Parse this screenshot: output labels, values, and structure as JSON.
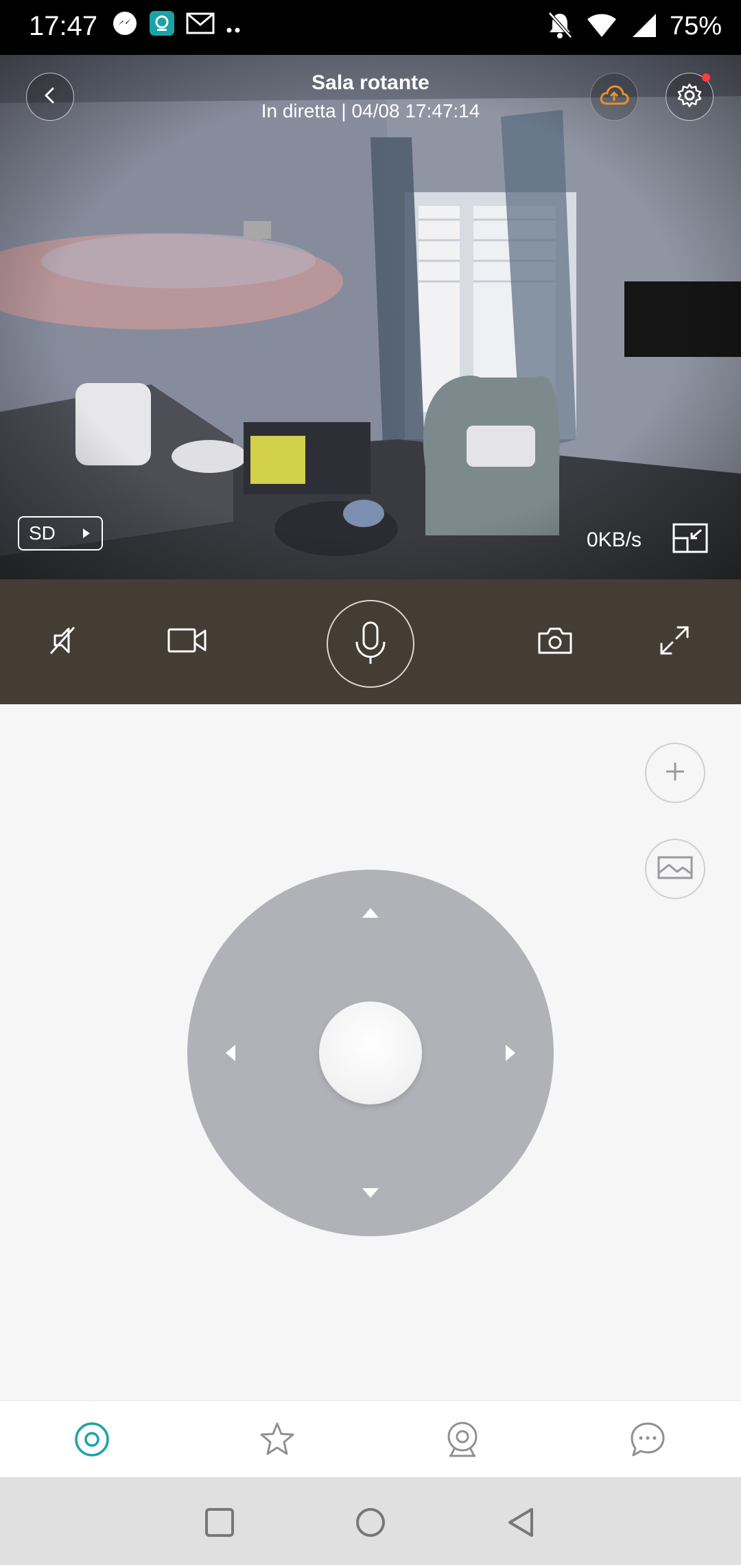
{
  "status_bar": {
    "time": "17:47",
    "battery": "75%",
    "left_icons": [
      "messenger-icon",
      "camera-app-icon",
      "gmail-icon",
      "more-dots-icon"
    ],
    "right_icons": [
      "mute-icon",
      "wifi-icon",
      "signal-icon"
    ]
  },
  "camera": {
    "title": "Sala rotante",
    "subtitle": "In diretta | 04/08 17:47:14",
    "quality_label": "SD",
    "speed": "0KB/s"
  },
  "controls": {
    "items": [
      "mute-icon",
      "record-icon",
      "microphone-icon",
      "snapshot-icon",
      "fullscreen-icon"
    ]
  },
  "side_actions": [
    "zoom-in-icon",
    "gallery-icon"
  ],
  "tabs": [
    "live-icon",
    "favorites-icon",
    "camera-icon",
    "messages-icon"
  ],
  "colors": {
    "accent": "#1aa3a6",
    "cloud": "#e8902a",
    "control_bar": "#453c34",
    "dpad": "#b1b1b8",
    "notification_dot": "#ff3b3b"
  }
}
